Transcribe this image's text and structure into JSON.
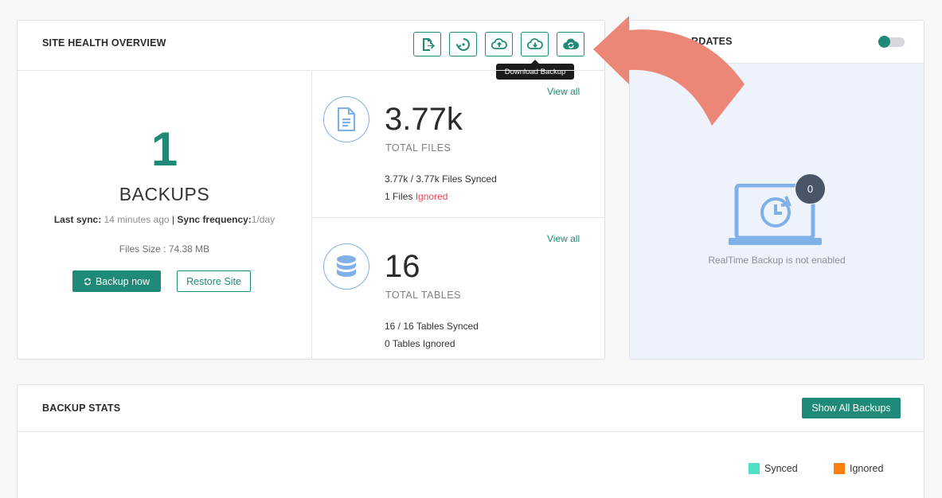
{
  "colors": {
    "accent": "#1f8a78",
    "ignored": "#e5455a",
    "synced": "#4fe0c5",
    "ignored_legend": "#ff7f0e",
    "arrow": "#ec8677"
  },
  "health": {
    "title": "SITE HEALTH OVERVIEW",
    "tooltip": "Download Backup",
    "toolbar": {
      "icons": [
        "file-export-icon",
        "restore-icon",
        "cloud-upload-icon",
        "cloud-download-icon",
        "cloud-sync-icon"
      ]
    },
    "backups": {
      "count": "1",
      "label": "BACKUPS",
      "last_sync_label": "Last sync:",
      "last_sync_value": "14 minutes ago",
      "separator": "|",
      "freq_label": "Sync frequency:",
      "freq_value": "1/day",
      "files_size": "Files Size : 74.38 MB",
      "backup_now": "Backup now",
      "restore_site": "Restore Site"
    },
    "files": {
      "view_all": "View all",
      "count": "3.77k",
      "label": "TOTAL FILES",
      "synced_value": "3.77k / 3.77k",
      "synced_text": "Files Synced",
      "ignored_value": "1",
      "ignored_prefix": "Files",
      "ignored_text": "Ignored"
    },
    "tables": {
      "view_all": "View all",
      "count": "16",
      "label": "TOTAL TABLES",
      "synced_value": "16 / 16",
      "synced_text": "Tables Synced",
      "ignored_value": "0",
      "ignored_text": "Tables Ignored"
    }
  },
  "realtime": {
    "title": "RDATES",
    "toggle_on": true,
    "badge": "0",
    "message": "RealTime Backup is not enabled"
  },
  "stats": {
    "title": "BACKUP STATS",
    "show_all": "Show All Backups",
    "legend": [
      {
        "label": "Synced",
        "color": "#4fe0c5"
      },
      {
        "label": "Ignored",
        "color": "#ff7f0e"
      }
    ]
  }
}
